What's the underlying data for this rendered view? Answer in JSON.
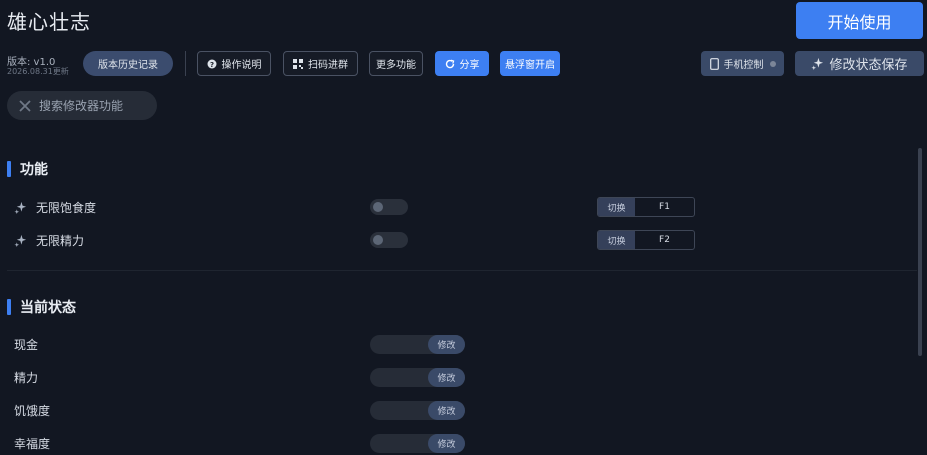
{
  "app": {
    "title": "雄心壮志",
    "start_label": "开始使用"
  },
  "version": {
    "label": "版本: v1.0",
    "date": "2026.08.31更新"
  },
  "toolbar": {
    "history": "版本历史记录",
    "guide": "操作说明",
    "qr": "扫码进群",
    "more": "更多功能",
    "share": "分享",
    "float": "悬浮窗开启",
    "phone": "手机控制",
    "save": "修改状态保存"
  },
  "search": {
    "placeholder": "搜索修改器功能"
  },
  "sections": {
    "features": {
      "title": "功能",
      "items": [
        {
          "label": "无限饱食度",
          "toggle": "off",
          "hotkey_btn": "切换",
          "hotkey": "F1"
        },
        {
          "label": "无限精力",
          "toggle": "off",
          "hotkey_btn": "切换",
          "hotkey": "F2"
        }
      ]
    },
    "status": {
      "title": "当前状态",
      "items": [
        {
          "label": "现金",
          "btn": "修改"
        },
        {
          "label": "精力",
          "btn": "修改"
        },
        {
          "label": "饥饿度",
          "btn": "修改"
        },
        {
          "label": "幸福度",
          "btn": "修改"
        }
      ]
    }
  },
  "icons": {
    "guide": "question-circle-icon",
    "qr": "qr-code-icon",
    "share": "share-icon",
    "phone": "phone-icon",
    "save": "sparkle-icon",
    "search": "cross-icon",
    "feature": "sparkle-icon"
  },
  "colors": {
    "accent": "#3d7ff2",
    "background": "#121722",
    "panel": "#262c37"
  }
}
